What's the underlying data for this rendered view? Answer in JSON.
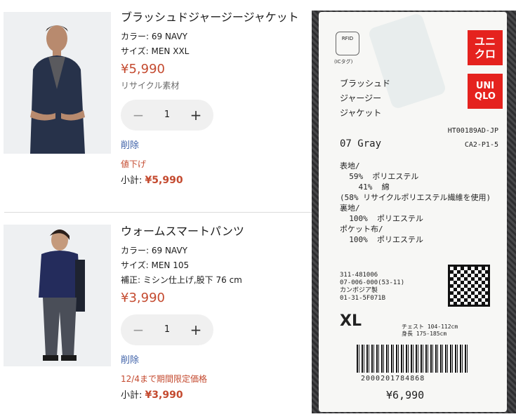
{
  "cart": {
    "items": [
      {
        "name": "ブラッシュドジャージージャケット",
        "color": "カラー: 69 NAVY",
        "size": "サイズ: MEN XXL",
        "price": "¥5,990",
        "note": "リサイクル素材",
        "quantity": "1",
        "remove_label": "削除",
        "promo": "値下げ",
        "subtotal_label": "小計:",
        "subtotal_value": "¥5,990"
      },
      {
        "name": "ウォームスマートパンツ",
        "color": "カラー: 69 NAVY",
        "size": "サイズ: MEN 105",
        "alteration": "補正: ミシン仕上げ,股下 76 cm",
        "price": "¥3,990",
        "quantity": "1",
        "remove_label": "削除",
        "promo": "12/4まで期間限定価格",
        "subtotal_label": "小計:",
        "subtotal_value": "¥3,990"
      }
    ],
    "icons": {
      "minus": "−",
      "plus": "+"
    }
  },
  "price_tag": {
    "rfid": "RFID",
    "rfid_caption": "(ICタグ)",
    "logo_top": "ユニ\nクロ",
    "logo_bottom": "UNI\nQLO",
    "product_name": "ブラッシュド\nジャージー\nジャケット",
    "product_code": "HT00189AD-JP\nCA2-P1-5",
    "color": "07 Gray",
    "materials": "表地/\n  59%  ポリエステル\n    41%  綿\n(58% リサイクルポリエステル繊維を使用)\n裏地/\n  100%  ポリエステル\nポケット布/\n  100%  ポリエステル",
    "codes": "311-481006\n07-006-000(53-11)\nカンボジア製\n01-31-5F071B",
    "size": "XL",
    "measurements": "チェスト 104-112cm\n身長 175-185cm",
    "barcode_number": "2000201784868",
    "price": "¥6,990"
  },
  "colors": {
    "sale_red": "#c44a2f",
    "link_blue": "#3e61a8",
    "uniqlo_red": "#e5221e"
  }
}
